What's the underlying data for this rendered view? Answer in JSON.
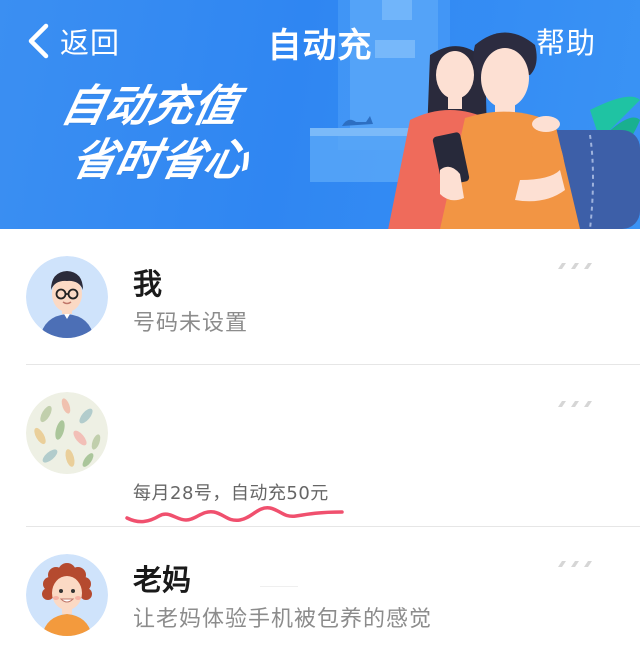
{
  "nav": {
    "back_label": "返回",
    "title": "自动充",
    "help_label": "帮助"
  },
  "banner": {
    "slogan_line1": "自动充值",
    "slogan_line2": "省时省心"
  },
  "contacts": [
    {
      "name": "我",
      "subtitle": "号码未设置",
      "avatar_icon": "avatar-man-glasses-icon"
    },
    {
      "name": "",
      "subtitle": "每月28号，自动充50元",
      "avatar_icon": "avatar-leaf-pattern-icon"
    },
    {
      "name": "老妈",
      "subtitle": "让老妈体验手机被包养的感觉",
      "avatar_icon": "avatar-woman-curly-icon"
    }
  ],
  "colors": {
    "banner_blue": "#3289f2",
    "annotation_red": "#f0506e",
    "text_primary": "#1a1a1a",
    "text_secondary": "#8c8c8c"
  }
}
